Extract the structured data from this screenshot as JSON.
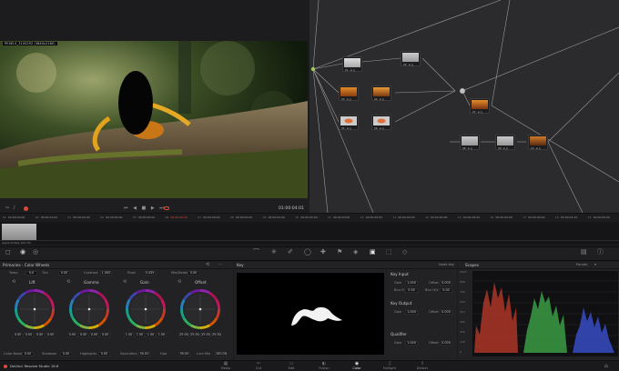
{
  "viewer": {
    "clip_name": "PEXELS_3100292 (3840x2160)",
    "timecode": "01:00:04:01"
  },
  "timeline": {
    "timecodes": [
      "00:00:00:00",
      "00:00:04:00",
      "00:00:00:00",
      "00:00:00:00",
      "00:00:00:00",
      "00:00:00:00",
      "00:00:00:00",
      "00:00:00:00",
      "00:00:00:00",
      "00:00:00:00",
      "00:00:00:00",
      "00:00:00:00",
      "00:00:00:00",
      "00:00:00:00",
      "00:00:00:00",
      "00:00:00:00",
      "00:00:00:00",
      "00:00:04:19",
      "00:00:00:00"
    ],
    "clip_numbers": [
      "01",
      "02",
      "03",
      "04",
      "05",
      "06",
      "07",
      "08",
      "09",
      "10",
      "11",
      "12",
      "13",
      "14",
      "15",
      "16",
      "17",
      "18",
      "19"
    ],
    "codec": "Apple ProRes 422 HQ"
  },
  "primaries": {
    "title": "Primaries - Color Wheels",
    "row1": [
      {
        "label": "Temp",
        "value": "0.0"
      },
      {
        "label": "Tint",
        "value": "0.00"
      },
      {
        "label": "Contrast",
        "value": "1.000"
      },
      {
        "label": "Pivot",
        "value": "0.435"
      },
      {
        "label": "Mid/Detail",
        "value": "0.00"
      }
    ],
    "wheels": [
      {
        "name": "Lift",
        "values": [
          "0.00",
          "0.00",
          "0.00",
          "0.00"
        ]
      },
      {
        "name": "Gamma",
        "values": [
          "0.00",
          "0.00",
          "0.00",
          "0.00"
        ]
      },
      {
        "name": "Gain",
        "values": [
          "1.00",
          "1.00",
          "1.00",
          "1.00"
        ]
      },
      {
        "name": "Offset",
        "values": [
          "25.00",
          "25.00",
          "25.00",
          "25.00"
        ]
      }
    ],
    "row2": [
      {
        "label": "Color Boost",
        "value": "0.00"
      },
      {
        "label": "Shadows",
        "value": "0.00"
      },
      {
        "label": "Highlights",
        "value": "0.00"
      },
      {
        "label": "Saturation",
        "value": "50.00"
      },
      {
        "label": "Hue",
        "value": "50.00"
      },
      {
        "label": "Lum Mix",
        "value": "100.00"
      }
    ]
  },
  "key": {
    "title": "Key",
    "subtitle": "Node Key",
    "input_label": "Key Input",
    "output_label": "Key Output",
    "qualifier_label": "Qualifier",
    "gain_label": "Gain",
    "gain_value": "1.000",
    "offset_label": "Offset",
    "offset_value": "0.000",
    "blur_r_label": "Blur R.",
    "blur_r_value": "0.50",
    "blur_h_label": "Blur H/V",
    "blur_h_value": "0.00"
  },
  "scopes": {
    "title": "Scopes",
    "mode": "Parade",
    "ticks": [
      "1023",
      "896",
      "768",
      "640",
      "512",
      "384",
      "256",
      "128",
      "0"
    ]
  },
  "footer": {
    "app_name": "DaVinci Resolve Studio 18.6",
    "pages": [
      "Media",
      "Cut",
      "Edit",
      "Fusion",
      "Color",
      "Fairlight",
      "Deliver"
    ],
    "active_page": "Color"
  },
  "colors": {
    "accent": "#d94a3b",
    "red_trace": "#c0392b",
    "green_trace": "#3fae49",
    "blue_trace": "#3a4fd0"
  }
}
